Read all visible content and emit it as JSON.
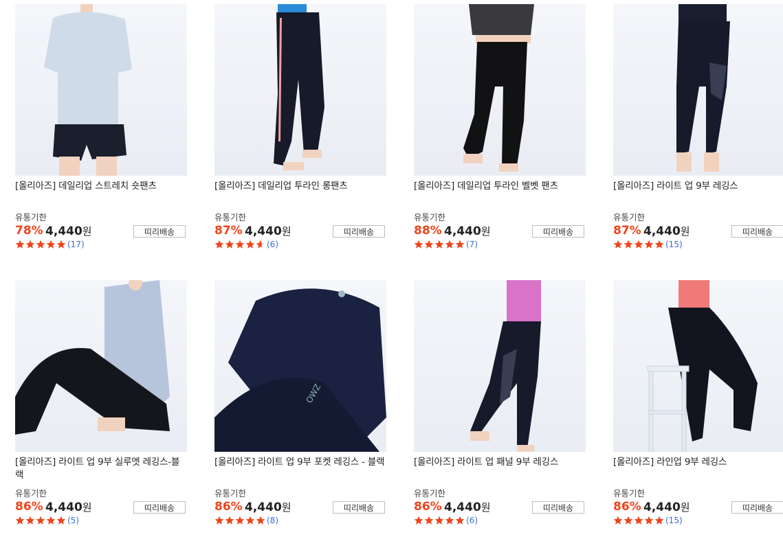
{
  "products": [
    {
      "title": "[올리아즈] 데일리업 스트레치 숏팬츠",
      "expiry_label": "유통기한",
      "discount": "78%",
      "price": "4,440",
      "currency": "원",
      "shipping": "띠리배송",
      "rating": 5,
      "reviews": "(17)",
      "image": "white-tshirt-black-shorts",
      "top_color": "#cfdbe8",
      "bottom_color": "#1b1e2c"
    },
    {
      "title": "[올리아즈] 데일리업 투라인 롱팬츠",
      "expiry_label": "유통기한",
      "discount": "87%",
      "price": "4,440",
      "currency": "원",
      "shipping": "띠리배송",
      "rating": 4.5,
      "reviews": "(6)",
      "image": "navy-pants-pink-stripe",
      "top_color": "#2a8ad8",
      "bottom_color": "#171a29"
    },
    {
      "title": "[올리아즈] 데일리업 투라인 벨벳 팬츠",
      "expiry_label": "유통기한",
      "discount": "88%",
      "price": "4,440",
      "currency": "원",
      "shipping": "띠리배송",
      "rating": 5,
      "reviews": "(7)",
      "image": "black-velvet-pants",
      "top_color": "#3a3a3e",
      "bottom_color": "#121214"
    },
    {
      "title": "[올리아즈] 라이트 업 9부 레깅스",
      "expiry_label": "유통기한",
      "discount": "87%",
      "price": "4,440",
      "currency": "원",
      "shipping": "띠리배송",
      "rating": 5,
      "reviews": "(15)",
      "image": "navy-mesh-leggings",
      "top_color": "#1a1d2e",
      "bottom_color": "#161a2b"
    },
    {
      "title": "[올리아즈] 라이트 업 9부 실루엣 레깅스-블랙",
      "expiry_label": "유통기한",
      "discount": "86%",
      "price": "4,440",
      "currency": "원",
      "shipping": "띠리배송",
      "rating": 5,
      "reviews": "(5)",
      "image": "seated-black-leggings",
      "top_color": "#b6c4dc",
      "bottom_color": "#15161c"
    },
    {
      "title": "[올리아즈] 라이트 업 9부 포켓 레깅스 - 블랙",
      "expiry_label": "유통기한",
      "discount": "86%",
      "price": "4,440",
      "currency": "원",
      "shipping": "띠리배송",
      "rating": 5,
      "reviews": "(8)",
      "image": "navy-longsleeve-set",
      "top_color": "#1b2140",
      "bottom_color": "#151a33"
    },
    {
      "title": "[올리아즈] 라이트 업 패널 9부 레깅스",
      "expiry_label": "유통기한",
      "discount": "86%",
      "price": "4,440",
      "currency": "원",
      "shipping": "띠리배송",
      "rating": 5,
      "reviews": "(6)",
      "image": "pink-top-panel-leggings",
      "top_color": "#d873c8",
      "bottom_color": "#171a2a"
    },
    {
      "title": "[올리아즈] 라인업 9부 레깅스",
      "expiry_label": "유통기한",
      "discount": "86%",
      "price": "4,440",
      "currency": "원",
      "shipping": "띠리배송",
      "rating": 5,
      "reviews": "(15)",
      "image": "coral-bra-stool-leggings",
      "top_color": "#f07a78",
      "bottom_color": "#12141f"
    }
  ],
  "colors": {
    "discount": "#f0441a",
    "star": "#f0441a",
    "review_link": "#3a6ad6"
  }
}
